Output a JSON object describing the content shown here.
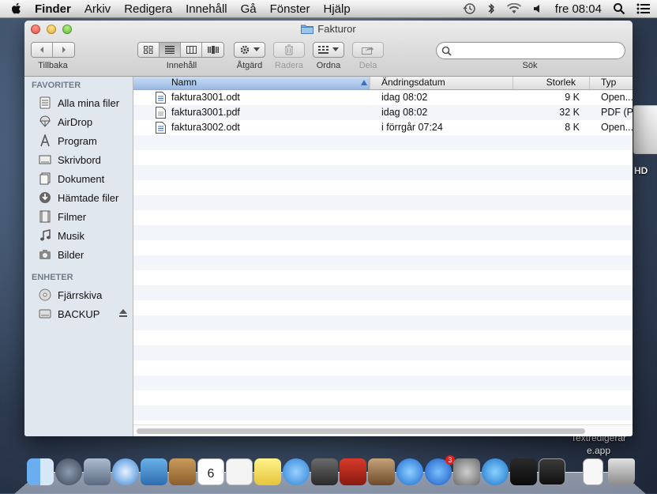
{
  "menubar": {
    "app_name": "Finder",
    "items": [
      "Arkiv",
      "Redigera",
      "Innehåll",
      "Gå",
      "Fönster",
      "Hjälp"
    ],
    "clock": "fre 08:04"
  },
  "window": {
    "title": "Fakturor",
    "toolbar": {
      "back_label": "Tillbaka",
      "view_label": "Innehåll",
      "action_label": "Åtgärd",
      "delete_label": "Radera",
      "arrange_label": "Ordna",
      "share_label": "Dela",
      "search_label": "Sök",
      "search_placeholder": ""
    }
  },
  "sidebar": {
    "favorites_header": "FAVORITER",
    "favorites": [
      {
        "label": "Alla mina filer",
        "icon": "all-files-icon"
      },
      {
        "label": "AirDrop",
        "icon": "airdrop-icon"
      },
      {
        "label": "Program",
        "icon": "applications-icon"
      },
      {
        "label": "Skrivbord",
        "icon": "desktop-icon"
      },
      {
        "label": "Dokument",
        "icon": "documents-icon"
      },
      {
        "label": "Hämtade filer",
        "icon": "downloads-icon"
      },
      {
        "label": "Filmer",
        "icon": "movies-icon"
      },
      {
        "label": "Musik",
        "icon": "music-icon"
      },
      {
        "label": "Bilder",
        "icon": "pictures-icon"
      }
    ],
    "devices_header": "ENHETER",
    "devices": [
      {
        "label": "Fjärrskiva",
        "icon": "remote-disc-icon"
      },
      {
        "label": "BACKUP",
        "icon": "drive-icon"
      }
    ]
  },
  "columns": {
    "name": "Namn",
    "date": "Ändringsdatum",
    "size": "Storlek",
    "kind": "Typ"
  },
  "files": [
    {
      "name": "faktura3001.odt",
      "date": "idag 08:02",
      "size": "9 K",
      "kind": "Open..."
    },
    {
      "name": "faktura3001.pdf",
      "date": "idag 08:02",
      "size": "32 K",
      "kind": "PDF (P..."
    },
    {
      "name": "faktura3002.odt",
      "date": "i förrgår 07:24",
      "size": "8 K",
      "kind": "Open..."
    }
  ],
  "desktop": {
    "drive_label": "HD",
    "app_label_line1": "Textredigerar",
    "app_label_line2": "e.app"
  },
  "dock": {
    "badge_count": "3",
    "calendar_day": "6"
  }
}
